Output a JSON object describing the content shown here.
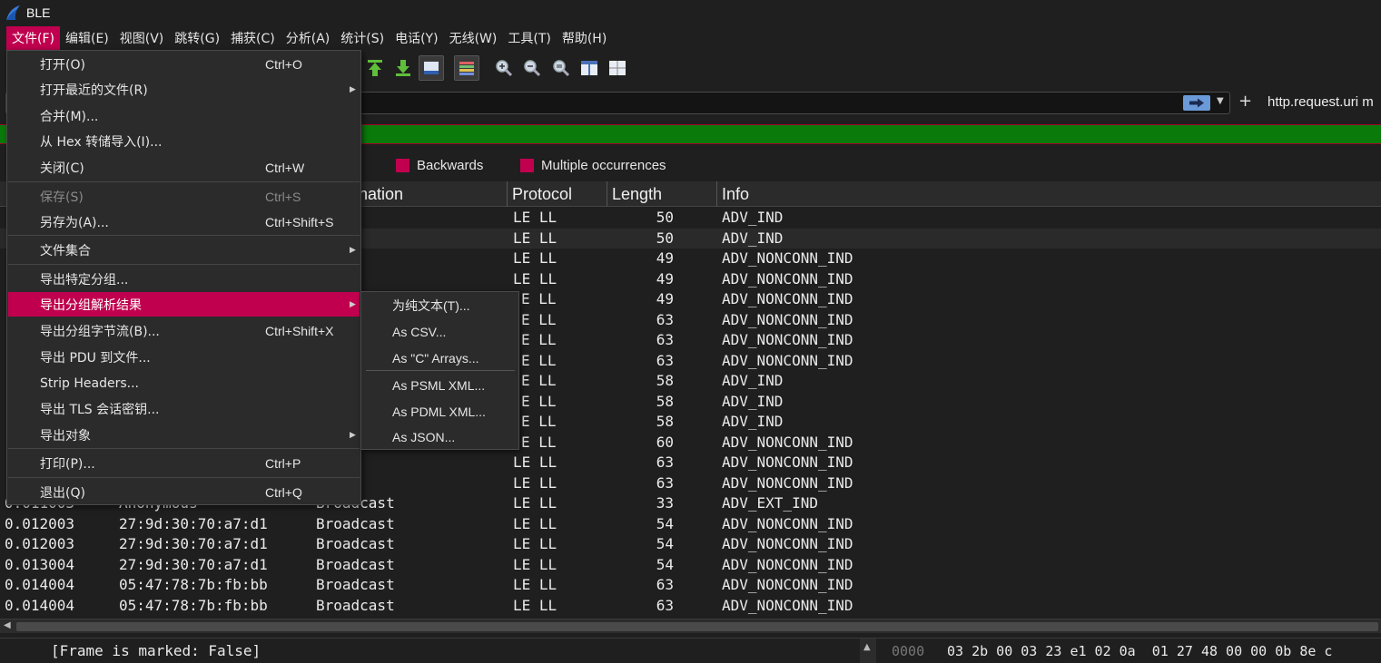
{
  "window": {
    "title": "BLE"
  },
  "menubar": [
    "文件(F)",
    "编辑(E)",
    "视图(V)",
    "跳转(G)",
    "捕获(C)",
    "分析(A)",
    "统计(S)",
    "电话(Y)",
    "无线(W)",
    "工具(T)",
    "帮助(H)"
  ],
  "filter": {
    "button_text": "http.request.uri m"
  },
  "legend": [
    "Backwards",
    "Multiple occurrences"
  ],
  "columns": {
    "destination": "nation",
    "protocol": "Protocol",
    "length": "Length",
    "info": "Info"
  },
  "rows": [
    {
      "time": "",
      "source": "",
      "destination": "cast",
      "protocol": "LE LL",
      "length": "50",
      "info": "ADV_IND"
    },
    {
      "time": "",
      "source": "",
      "destination": "cast",
      "protocol": "LE LL",
      "length": "50",
      "info": "ADV_IND"
    },
    {
      "time": "",
      "source": "",
      "destination": "cast",
      "protocol": "LE LL",
      "length": "49",
      "info": "ADV_NONCONN_IND"
    },
    {
      "time": "",
      "source": "",
      "destination": "cast",
      "protocol": "LE LL",
      "length": "49",
      "info": "ADV_NONCONN_IND"
    },
    {
      "time": "",
      "source": "",
      "destination": "",
      "protocol": "E LL",
      "length": "49",
      "info": "ADV_NONCONN_IND"
    },
    {
      "time": "",
      "source": "",
      "destination": "",
      "protocol": "E LL",
      "length": "63",
      "info": "ADV_NONCONN_IND"
    },
    {
      "time": "",
      "source": "",
      "destination": "",
      "protocol": "E LL",
      "length": "63",
      "info": "ADV_NONCONN_IND"
    },
    {
      "time": "",
      "source": "",
      "destination": "",
      "protocol": "E LL",
      "length": "63",
      "info": "ADV_NONCONN_IND"
    },
    {
      "time": "",
      "source": "",
      "destination": "",
      "protocol": "E LL",
      "length": "58",
      "info": "ADV_IND"
    },
    {
      "time": "",
      "source": "",
      "destination": "",
      "protocol": "E LL",
      "length": "58",
      "info": "ADV_IND"
    },
    {
      "time": "",
      "source": "",
      "destination": "",
      "protocol": "E LL",
      "length": "58",
      "info": "ADV_IND"
    },
    {
      "time": "",
      "source": "",
      "destination": "",
      "protocol": "E LL",
      "length": "60",
      "info": "ADV_NONCONN_IND"
    },
    {
      "time": "",
      "source": "",
      "destination": "cast",
      "protocol": "LE LL",
      "length": "63",
      "info": "ADV_NONCONN_IND"
    },
    {
      "time": "",
      "source": "",
      "destination": "cast",
      "protocol": "LE LL",
      "length": "63",
      "info": "ADV_NONCONN_IND"
    },
    {
      "time": "0.011003",
      "source": "Anonymous",
      "destination": "Broadcast",
      "protocol": "LE LL",
      "length": "33",
      "info": "ADV_EXT_IND"
    },
    {
      "time": "0.012003",
      "source": "27:9d:30:70:a7:d1",
      "destination": "Broadcast",
      "protocol": "LE LL",
      "length": "54",
      "info": "ADV_NONCONN_IND"
    },
    {
      "time": "0.012003",
      "source": "27:9d:30:70:a7:d1",
      "destination": "Broadcast",
      "protocol": "LE LL",
      "length": "54",
      "info": "ADV_NONCONN_IND"
    },
    {
      "time": "0.013004",
      "source": "27:9d:30:70:a7:d1",
      "destination": "Broadcast",
      "protocol": "LE LL",
      "length": "54",
      "info": "ADV_NONCONN_IND"
    },
    {
      "time": "0.014004",
      "source": "05:47:78:7b:fb:bb",
      "destination": "Broadcast",
      "protocol": "LE LL",
      "length": "63",
      "info": "ADV_NONCONN_IND"
    },
    {
      "time": "0.014004",
      "source": "05:47:78:7b:fb:bb",
      "destination": "Broadcast",
      "protocol": "LE LL",
      "length": "63",
      "info": "ADV_NONCONN_IND"
    }
  ],
  "detail": {
    "text": "[Frame is marked: False]"
  },
  "hex": {
    "offset": "0000",
    "bytes": "03 2b 00 03 23 e1 02 0a  01 27 48 00 00 0b 8e c"
  },
  "file_menu": {
    "items": [
      {
        "label": "打开(O)",
        "shortcut": "Ctrl+O"
      },
      {
        "label": "打开最近的文件(R)",
        "shortcut": "",
        "submenu": true
      },
      {
        "label": "合并(M)...",
        "shortcut": ""
      },
      {
        "label": "从 Hex 转储导入(I)...",
        "shortcut": ""
      },
      {
        "label": "关闭(C)",
        "shortcut": "Ctrl+W"
      },
      {
        "label": "保存(S)",
        "shortcut": "Ctrl+S",
        "disabled": true
      },
      {
        "label": "另存为(A)...",
        "shortcut": "Ctrl+Shift+S"
      },
      {
        "label": "文件集合",
        "shortcut": "",
        "submenu": true
      },
      {
        "label": "导出特定分组...",
        "shortcut": ""
      },
      {
        "label": "导出分组解析结果",
        "shortcut": "",
        "submenu": true,
        "highlighted": true
      },
      {
        "label": "导出分组字节流(B)...",
        "shortcut": "Ctrl+Shift+X"
      },
      {
        "label": "导出 PDU 到文件...",
        "shortcut": ""
      },
      {
        "label": "Strip Headers...",
        "shortcut": ""
      },
      {
        "label": "导出 TLS 会话密钥...",
        "shortcut": ""
      },
      {
        "label": "导出对象",
        "shortcut": "",
        "submenu": true
      },
      {
        "label": "打印(P)...",
        "shortcut": "Ctrl+P"
      },
      {
        "label": "退出(Q)",
        "shortcut": "Ctrl+Q"
      }
    ]
  },
  "export_submenu": {
    "items": [
      "为纯文本(T)...",
      "As CSV...",
      "As \"C\" Arrays...",
      "As PSML XML...",
      "As PDML XML...",
      "As JSON..."
    ]
  },
  "colors": {
    "accent": "#c0004e",
    "filter_ok": "#0a7a0a",
    "background": "#1f1f1f"
  }
}
